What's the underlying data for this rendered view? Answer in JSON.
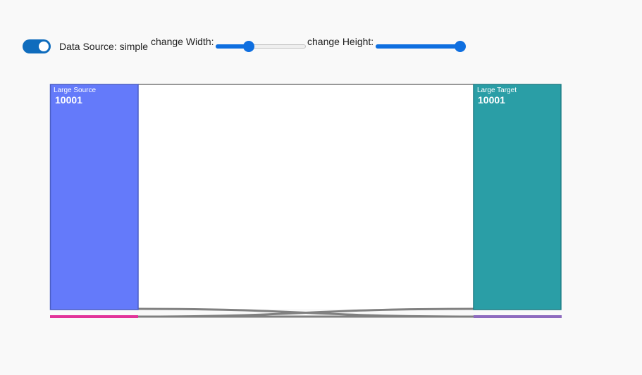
{
  "controls": {
    "data_source_label": "Data Source: simple",
    "data_source_on": true,
    "width_label": "change Width:",
    "height_label": "change Height:",
    "width_slider_fraction": 0.37,
    "height_slider_fraction": 0.94
  },
  "sankey": {
    "source_node": {
      "label": "Large Source",
      "value": "10001",
      "color": "#647afa",
      "border": "#4a5cc4"
    },
    "target_node": {
      "label": "Large Target",
      "value": "10001",
      "color": "#2a9ea6",
      "border": "#1e7f86"
    },
    "small_source_color": "#e2349a",
    "small_target_color": "#8e6bbf",
    "link_color": "#808080",
    "large_link_color": "#ffffff"
  }
}
